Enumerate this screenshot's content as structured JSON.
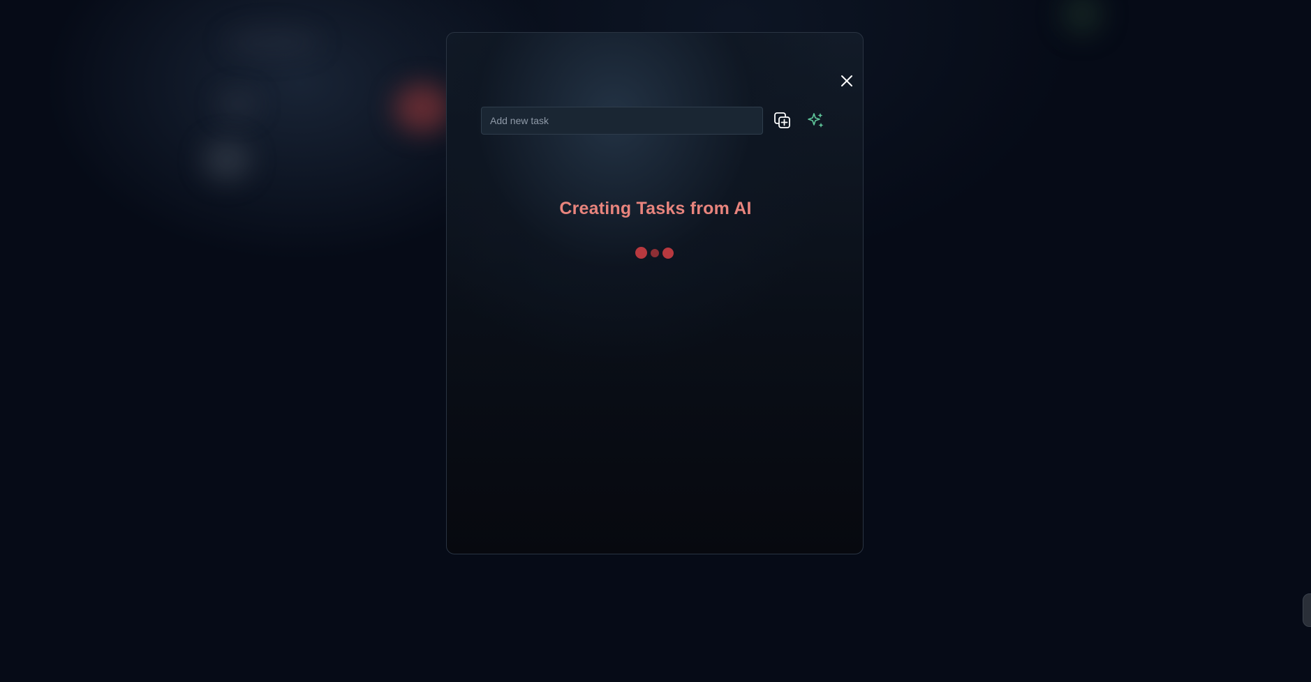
{
  "modal": {
    "input": {
      "value": "",
      "placeholder": "Add new task"
    },
    "close_icon": "close-icon",
    "copy_add_icon": "copy-add-icon",
    "ai_sparkle_icon": "sparkles-icon",
    "status_title": "Creating Tasks from AI",
    "loader": "loading-dots"
  },
  "colors": {
    "background": "#060b17",
    "title": "#e8847d",
    "loader_dot": "#b8393f",
    "ai_icon": "#5fc59a",
    "icon": "#ffffff"
  }
}
